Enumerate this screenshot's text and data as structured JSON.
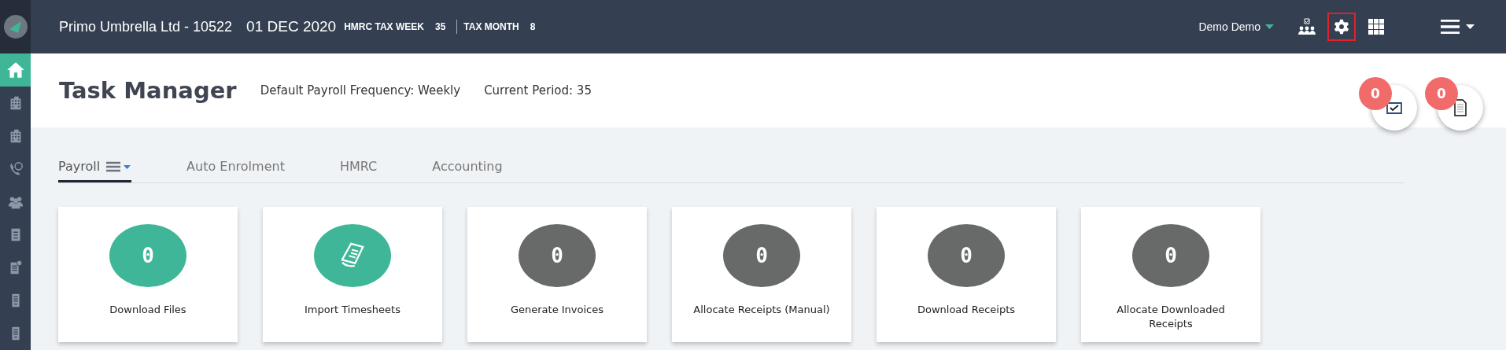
{
  "topbar": {
    "company": "Primo Umbrella Ltd  - 10522",
    "date": "01 DEC 2020",
    "tax_week_label": "HMRC TAX WEEK",
    "tax_week": "35",
    "tax_month_label": "TAX MONTH",
    "tax_month": "8",
    "user": "Demo Demo",
    "tools": [
      {
        "highlighted": false
      },
      {
        "highlighted": true
      },
      {
        "highlighted": false
      }
    ]
  },
  "sidebar": {
    "items": [
      {
        "selected": true
      },
      {
        "selected": false
      },
      {
        "selected": false
      },
      {
        "selected": false
      },
      {
        "selected": false
      },
      {
        "selected": false
      },
      {
        "selected": false
      },
      {
        "selected": false
      },
      {
        "selected": false
      }
    ]
  },
  "header": {
    "title": "Task Manager",
    "frequency": "Default Payroll Frequency: Weekly",
    "period": "Current Period: 35",
    "notifications": [
      {
        "count": "0"
      },
      {
        "count": "0"
      }
    ]
  },
  "tabs": [
    {
      "label": "Payroll",
      "selected": true
    },
    {
      "label": "Auto Enrolment",
      "selected": false
    },
    {
      "label": "HMRC",
      "selected": false
    },
    {
      "label": "Accounting",
      "selected": false
    }
  ],
  "tasks": [
    {
      "kind": "count",
      "count": "0",
      "label": "Download Files",
      "color": "#3fb697"
    },
    {
      "kind": "icon",
      "label": "Import Timesheets",
      "color": "#3fb697"
    },
    {
      "kind": "count",
      "count": "0",
      "label": "Generate Invoices",
      "color": "#676a68"
    },
    {
      "kind": "count",
      "count": "0",
      "label": "Allocate Receipts (Manual)",
      "color": "#676a68"
    },
    {
      "kind": "count",
      "count": "0",
      "label": "Download Receipts",
      "color": "#676a68"
    },
    {
      "kind": "count",
      "count": "0",
      "label": "Allocate Downloaded Receipts",
      "color": "#676a68"
    }
  ]
}
